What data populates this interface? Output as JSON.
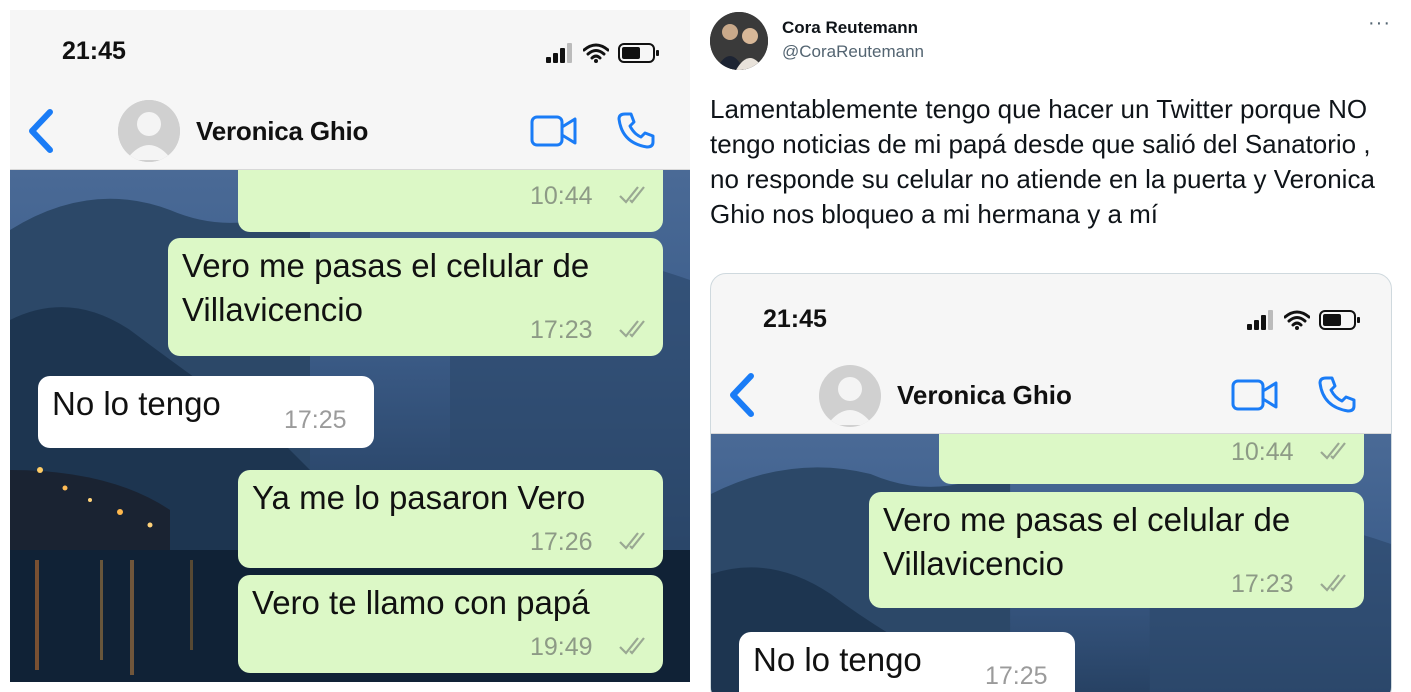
{
  "phone": {
    "status_time": "21:45",
    "contact_name": "Veronica Ghio",
    "icons": [
      "signal-icon",
      "wifi-icon",
      "battery-icon",
      "back-chevron-icon",
      "video-call-icon",
      "phone-call-icon"
    ]
  },
  "messages": [
    {
      "direction": "out",
      "text": "",
      "time": "10:44"
    },
    {
      "direction": "out",
      "text_line1": "Vero me pasas el celular de",
      "text_line2": "Villavicencio",
      "time": "17:23"
    },
    {
      "direction": "in",
      "text": "No lo tengo",
      "time": "17:25"
    },
    {
      "direction": "out",
      "text": "Ya me lo pasaron Vero",
      "time": "17:26"
    },
    {
      "direction": "out",
      "text": "Vero te llamo con papá",
      "time": "19:49"
    }
  ],
  "tweet": {
    "author_name": "Cora Reutemann",
    "author_handle": "@CoraReutemann",
    "more_label": "···",
    "text": "Lamentablemente tengo que hacer un Twitter porque NO tengo noticias de mi papá desde que salió del Sanatorio , no responde su celular no atiende en la puerta y Veronica Ghio nos bloqueo a mi hermana y a mí"
  },
  "colors": {
    "outgoing_bubble": "#dcf8c6",
    "incoming_bubble": "#ffffff",
    "ios_blue": "#1a7cf6",
    "tweet_text": "#0f1419",
    "tweet_secondary": "#536471"
  }
}
